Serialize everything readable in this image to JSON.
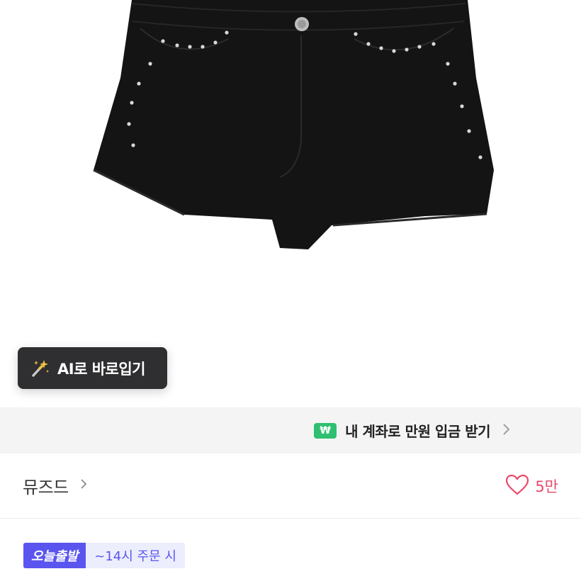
{
  "ai_try_on": {
    "label": "AI로 바로입기",
    "icon": "magic-wand-icon"
  },
  "banner": {
    "text": "내 계좌로 만원 입금 받기",
    "icon_glyph": "₩",
    "icon_color": "#2fbf71"
  },
  "seller": {
    "name": "뮤즈드"
  },
  "like": {
    "count": "5만",
    "color": "#e94a68"
  },
  "shipping": {
    "badge": "오늘출발",
    "note": "~14시 주문 시",
    "badge_color": "#5a55ee"
  }
}
